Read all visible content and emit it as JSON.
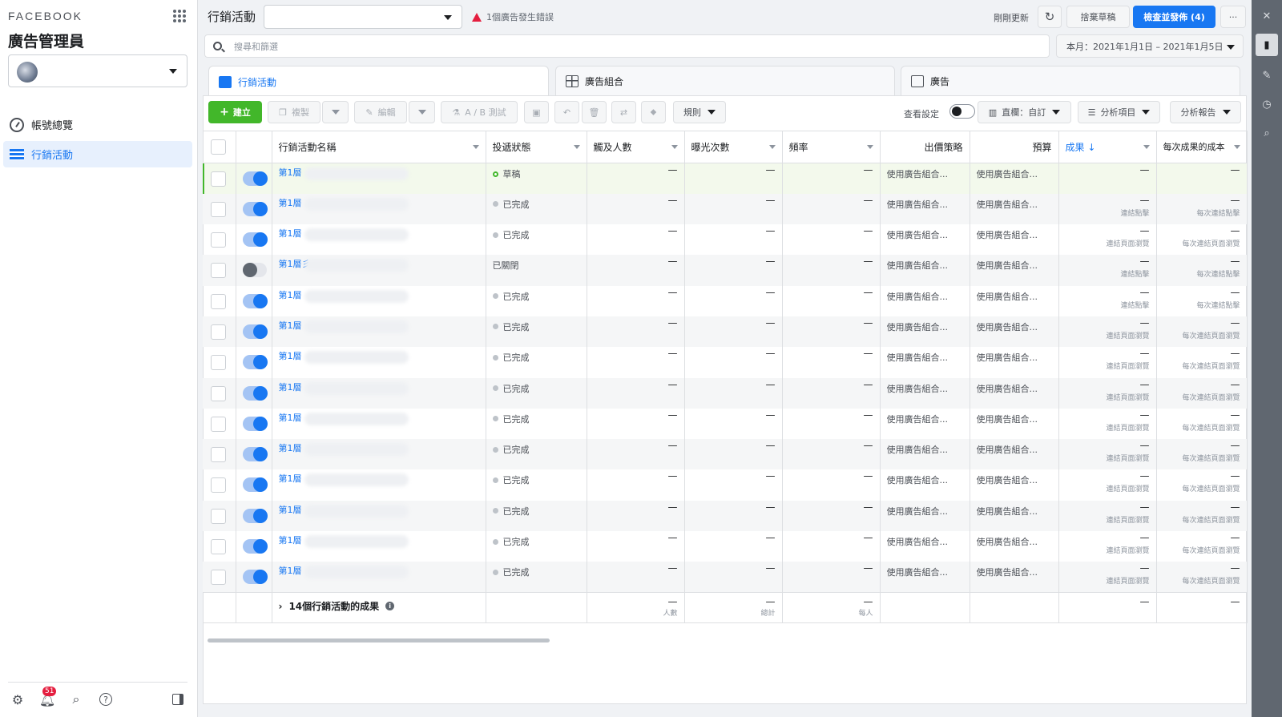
{
  "sidebar": {
    "brand": "FACEBOOK",
    "app_title": "廣告管理員",
    "nav": [
      {
        "label": "帳號總覽",
        "icon": "gauge-icon"
      },
      {
        "label": "行銷活動",
        "icon": "table-icon",
        "active": true
      }
    ],
    "notification_count": "51"
  },
  "topbar": {
    "title": "行銷活動",
    "error_text": "1個廣告發生錯誤",
    "refresh_text": "剛剛更新",
    "discard_label": "捨棄草稿",
    "publish_label": "檢查並發佈 (4)",
    "more_label": "···"
  },
  "search": {
    "placeholder": "搜尋和篩選"
  },
  "date_range": "本月：2021年1月1日 – 2021年1月5日",
  "tabs": [
    {
      "label": "行銷活動",
      "active": true
    },
    {
      "label": "廣告組合"
    },
    {
      "label": "廣告"
    }
  ],
  "toolbar": {
    "create": "建立",
    "duplicate": "複製",
    "edit": "編輯",
    "ab_test": "A / B 測試",
    "rules": "規則",
    "view_setup": "查看設定",
    "columns": "直欄：自訂",
    "breakdown": "分析項目",
    "reports": "分析報告"
  },
  "columns": [
    "行銷活動名稱",
    "投遞狀態",
    "觸及人數",
    "曝光次數",
    "頻率",
    "出價策略",
    "預算",
    "成果",
    "每次成果的成本"
  ],
  "rows": [
    {
      "name": "第1層",
      "status": "草稿",
      "status_type": "draft",
      "on": true,
      "reach": "—",
      "impr": "—",
      "freq": "—",
      "bid": "使用廣告組合...",
      "budget": "使用廣告組合...",
      "result": "—",
      "result_sub": "",
      "cost": "—",
      "cost_sub": ""
    },
    {
      "name": "第1層",
      "status": "已完成",
      "status_type": "done",
      "on": true,
      "reach": "—",
      "impr": "—",
      "freq": "—",
      "bid": "使用廣告組合...",
      "budget": "使用廣告組合...",
      "result": "—",
      "result_sub": "連結點擊",
      "cost": "—",
      "cost_sub": "每次連結點擊"
    },
    {
      "name": "第1層",
      "status": "已完成",
      "status_type": "done",
      "on": true,
      "reach": "—",
      "impr": "—",
      "freq": "—",
      "bid": "使用廣告組合...",
      "budget": "使用廣告組合...",
      "result": "—",
      "result_sub": "連結頁面瀏覽",
      "cost": "—",
      "cost_sub": "每次連結頁面瀏覽"
    },
    {
      "name": "第1層彡",
      "status": "已關閉",
      "status_type": "off",
      "on": false,
      "reach": "—",
      "impr": "—",
      "freq": "—",
      "bid": "使用廣告組合...",
      "budget": "使用廣告組合...",
      "result": "—",
      "result_sub": "連結點擊",
      "cost": "—",
      "cost_sub": "每次連結點擊"
    },
    {
      "name": "第1層",
      "status": "已完成",
      "status_type": "done",
      "on": true,
      "reach": "—",
      "impr": "—",
      "freq": "—",
      "bid": "使用廣告組合...",
      "budget": "使用廣告組合...",
      "result": "—",
      "result_sub": "連結點擊",
      "cost": "—",
      "cost_sub": "每次連結點擊"
    },
    {
      "name": "第1層",
      "status": "已完成",
      "status_type": "done",
      "on": true,
      "reach": "—",
      "impr": "—",
      "freq": "—",
      "bid": "使用廣告組合...",
      "budget": "使用廣告組合...",
      "result": "—",
      "result_sub": "連結頁面瀏覽",
      "cost": "—",
      "cost_sub": "每次連結頁面瀏覽"
    },
    {
      "name": "第1層",
      "status": "已完成",
      "status_type": "done",
      "on": true,
      "reach": "—",
      "impr": "—",
      "freq": "—",
      "bid": "使用廣告組合...",
      "budget": "使用廣告組合...",
      "result": "—",
      "result_sub": "連結頁面瀏覽",
      "cost": "—",
      "cost_sub": "每次連結頁面瀏覽"
    },
    {
      "name": "第1層",
      "status": "已完成",
      "status_type": "done",
      "on": true,
      "reach": "—",
      "impr": "—",
      "freq": "—",
      "bid": "使用廣告組合...",
      "budget": "使用廣告組合...",
      "result": "—",
      "result_sub": "連結頁面瀏覽",
      "cost": "—",
      "cost_sub": "每次連結頁面瀏覽"
    },
    {
      "name": "第1層",
      "status": "已完成",
      "status_type": "done",
      "on": true,
      "reach": "—",
      "impr": "—",
      "freq": "—",
      "bid": "使用廣告組合...",
      "budget": "使用廣告組合...",
      "result": "—",
      "result_sub": "連結頁面瀏覽",
      "cost": "—",
      "cost_sub": "每次連結頁面瀏覽"
    },
    {
      "name": "第1層",
      "status": "已完成",
      "status_type": "done",
      "on": true,
      "reach": "—",
      "impr": "—",
      "freq": "—",
      "bid": "使用廣告組合...",
      "budget": "使用廣告組合...",
      "result": "—",
      "result_sub": "連結頁面瀏覽",
      "cost": "—",
      "cost_sub": "每次連結頁面瀏覽"
    },
    {
      "name": "第1層",
      "status": "已完成",
      "status_type": "done",
      "on": true,
      "reach": "—",
      "impr": "—",
      "freq": "—",
      "bid": "使用廣告組合...",
      "budget": "使用廣告組合...",
      "result": "—",
      "result_sub": "連結頁面瀏覽",
      "cost": "—",
      "cost_sub": "每次連結頁面瀏覽"
    },
    {
      "name": "第1層",
      "status": "已完成",
      "status_type": "done",
      "on": true,
      "reach": "—",
      "impr": "—",
      "freq": "—",
      "bid": "使用廣告組合...",
      "budget": "使用廣告組合...",
      "result": "—",
      "result_sub": "連結頁面瀏覽",
      "cost": "—",
      "cost_sub": "每次連結頁面瀏覽"
    },
    {
      "name": "第1層",
      "status": "已完成",
      "status_type": "done",
      "on": true,
      "reach": "—",
      "impr": "—",
      "freq": "—",
      "bid": "使用廣告組合...",
      "budget": "使用廣告組合...",
      "result": "—",
      "result_sub": "連結頁面瀏覽",
      "cost": "—",
      "cost_sub": "每次連結頁面瀏覽"
    },
    {
      "name": "第1層",
      "status": "已完成",
      "status_type": "done",
      "on": true,
      "reach": "—",
      "impr": "—",
      "freq": "—",
      "bid": "使用廣告組合...",
      "budget": "使用廣告組合...",
      "result": "—",
      "result_sub": "連結頁面瀏覽",
      "cost": "—",
      "cost_sub": "每次連結頁面瀏覽"
    }
  ],
  "totals": {
    "label": "14個行銷活動的成果",
    "reach": "—",
    "reach_sub": "人數",
    "impr": "—",
    "impr_sub": "總計",
    "freq": "—",
    "freq_sub": "每人",
    "result": "—",
    "cost": "—"
  },
  "colors": {
    "accent": "#1877f2",
    "create": "#42b72a",
    "error": "#e41e3f"
  }
}
